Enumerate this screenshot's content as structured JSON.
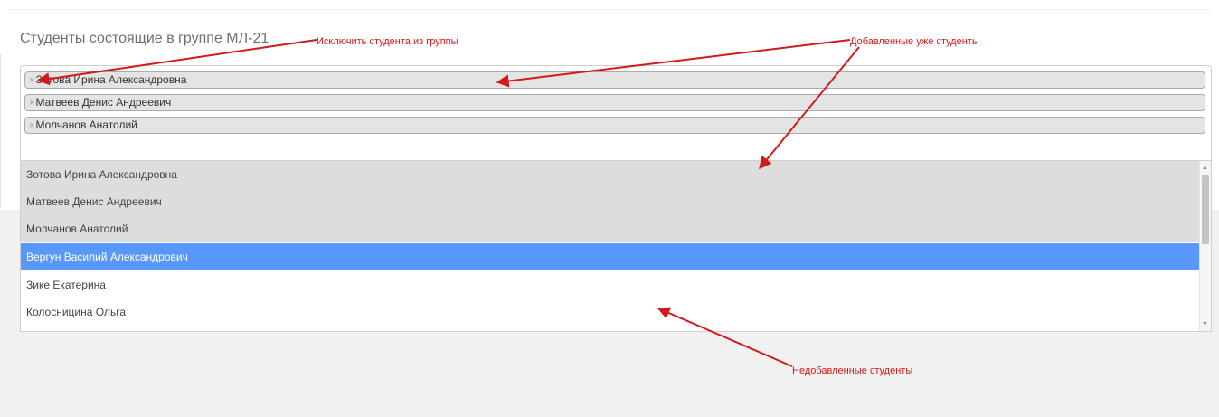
{
  "section_title": "Студенты состоящие в группе МЛ-21",
  "selected_chips": [
    {
      "remove_glyph": "×",
      "label": "Зотова Ирина Александровна"
    },
    {
      "remove_glyph": "×",
      "label": "Матвеев Денис Андреевич"
    },
    {
      "remove_glyph": "×",
      "label": "Молчанов Анатолий"
    }
  ],
  "dropdown_options": [
    {
      "label": "Зотова Ирина Александровна",
      "state": "selected"
    },
    {
      "label": "Матвеев Денис Андреевич",
      "state": "selected"
    },
    {
      "label": "Молчанов Анатолий",
      "state": "selected"
    },
    {
      "label": "Вергун Василий Александрович",
      "state": "highlighted"
    },
    {
      "label": "Зике Екатерина",
      "state": "plain"
    },
    {
      "label": "Колосницина Ольга",
      "state": "plain"
    }
  ],
  "annotations": {
    "remove_student": "Исключить студента из группы",
    "already_added": "Добавленные уже студенты",
    "not_added": "Недобавленные студенты"
  },
  "colors": {
    "annotation": "#d11a1a",
    "highlight": "#5897fb",
    "selected_option_bg": "#dddddd",
    "chip_bg": "#e4e4e4"
  },
  "icons": {
    "scroll_up": "up-triangle",
    "scroll_down": "down-triangle",
    "remove": "times"
  }
}
